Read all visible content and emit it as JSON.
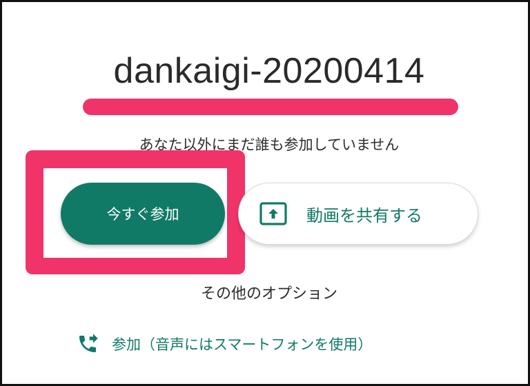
{
  "meeting": {
    "code": "dankaigi-20200414",
    "participants_note": "あなた以外にまだ誰も参加していません"
  },
  "actions": {
    "join_now_label": "今すぐ参加",
    "share_screen_label": "動画を共有する",
    "other_options_label": "その他のオプション",
    "phone_join_label": "参加（音声にはスマートフォンを使用）"
  },
  "icons": {
    "share": "present-to-all-icon",
    "phone": "phone-forwarded-icon"
  },
  "colors": {
    "accent": "#117a67",
    "highlight": "#f0346a"
  }
}
